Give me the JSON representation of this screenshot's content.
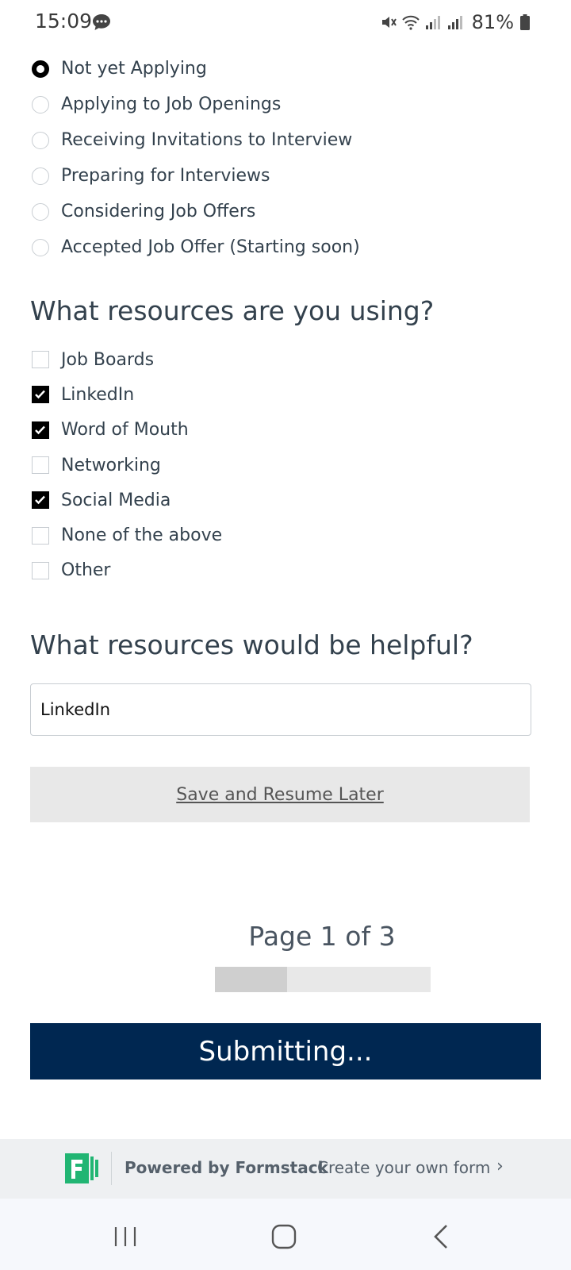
{
  "status_bar": {
    "time": "15:09",
    "battery": "81%",
    "icons": [
      "chat-bubble-icon",
      "mute-icon",
      "wifi-icon",
      "signal-icon",
      "signal-icon",
      "battery-icon"
    ]
  },
  "job_status": {
    "options": [
      {
        "label": "Not yet Applying",
        "checked": true
      },
      {
        "label": "Applying to Job Openings",
        "checked": false
      },
      {
        "label": "Receiving Invitations to Interview",
        "checked": false
      },
      {
        "label": "Preparing for Interviews",
        "checked": false
      },
      {
        "label": "Considering Job Offers",
        "checked": false
      },
      {
        "label": "Accepted Job Offer (Starting soon)",
        "checked": false
      }
    ]
  },
  "resources_using": {
    "question": "What resources are you using?",
    "options": [
      {
        "label": "Job Boards",
        "checked": false
      },
      {
        "label": "LinkedIn",
        "checked": true
      },
      {
        "label": "Word of Mouth",
        "checked": true
      },
      {
        "label": "Networking",
        "checked": false
      },
      {
        "label": "Social Media",
        "checked": true
      },
      {
        "label": "None of the above",
        "checked": false
      },
      {
        "label": "Other",
        "checked": false
      }
    ]
  },
  "resources_helpful": {
    "question": "What resources would be helpful?",
    "value": "LinkedIn"
  },
  "save_label": "Save and Resume Later",
  "page_indicator": "Page 1 of 3",
  "progress_fraction": 0.333,
  "submit_label": "Submitting...",
  "footer": {
    "powered_by": "Powered by Formstack",
    "create_link": "Create your own form",
    "chevron": "›"
  },
  "colors": {
    "submit_bg": "#002751",
    "text": "#33414d",
    "logo_green": "#21b573"
  }
}
